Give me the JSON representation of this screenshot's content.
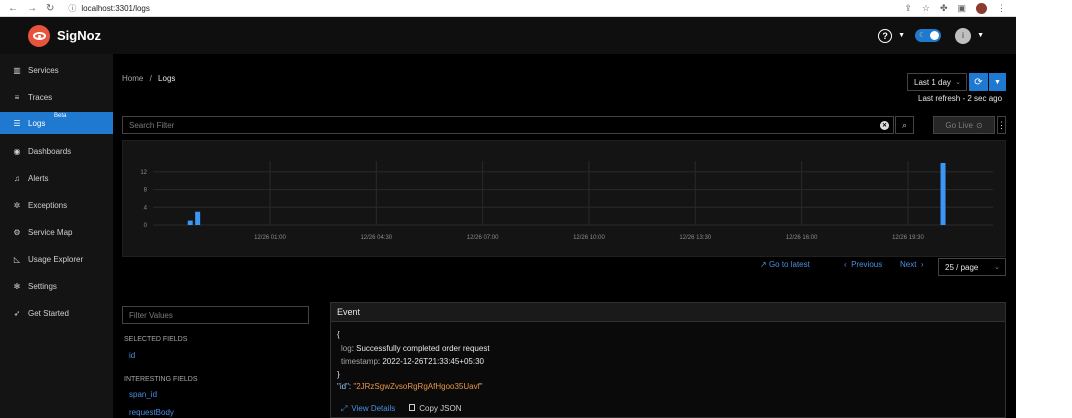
{
  "browser": {
    "url": "localhost:3301/logs"
  },
  "app": {
    "name": "SigNoz",
    "avatar_letter": "i"
  },
  "colors": {
    "accent": "#1f79d0",
    "logo": "#e8543b",
    "link": "#4a90e2",
    "bar": "#3a97f5"
  },
  "sidebar": {
    "items": [
      {
        "label": "Services",
        "icon": "bar-chart-icon"
      },
      {
        "label": "Traces",
        "icon": "menu-icon"
      },
      {
        "label": "Logs",
        "icon": "list-icon",
        "badge": "Beta",
        "active": true
      },
      {
        "label": "Dashboards",
        "icon": "dashboard-icon"
      },
      {
        "label": "Alerts",
        "icon": "bell-icon"
      },
      {
        "label": "Exceptions",
        "icon": "bug-icon"
      },
      {
        "label": "Service Map",
        "icon": "deployment-icon"
      },
      {
        "label": "Usage Explorer",
        "icon": "line-chart-icon"
      },
      {
        "label": "Settings",
        "icon": "gear-icon"
      },
      {
        "label": "Get Started",
        "icon": "rocket-icon"
      }
    ]
  },
  "main": {
    "breadcrumb": {
      "home": "Home",
      "sep": "/",
      "current": "Logs"
    },
    "time_range": "Last 1 day",
    "last_refresh": "Last refresh - 2 sec ago",
    "search_placeholder": "Search Filter",
    "go_live": "Go Live",
    "pagination": {
      "go_to_latest": "Go to latest",
      "previous": "Previous",
      "next": "Next",
      "page_size": "25 / page"
    }
  },
  "chart_data": {
    "type": "bar",
    "yticks": [
      "12",
      "8",
      "4",
      "0"
    ],
    "ylim": [
      0,
      14
    ],
    "x_tick_labels": [
      "12/26 01:00",
      "12/26 04:30",
      "12/26 07:00",
      "12/26 10:00",
      "12/26 13:30",
      "12/26 16:00",
      "12/26 19:30"
    ],
    "x_tick_positions": [
      1,
      2,
      3,
      4,
      5,
      6,
      7
    ],
    "x_range": [
      -0.1,
      7.8
    ],
    "bars": [
      {
        "x": 0.25,
        "value": 1
      },
      {
        "x": 0.32,
        "value": 3
      },
      {
        "x": 7.33,
        "value": 14
      }
    ],
    "grid": true
  },
  "filters": {
    "placeholder": "Filter Values",
    "selected_heading": "SELECTED FIELDS",
    "selected": [
      "id"
    ],
    "interesting_heading": "INTERESTING FIELDS",
    "interesting": [
      "span_id",
      "requestBody"
    ]
  },
  "event": {
    "header": "Event",
    "open_brace": "{",
    "log_key": "log",
    "log_value": "Successfully completed order request",
    "timestamp_key": "timestamp",
    "timestamp_value": "2022-12-26T21:33:45+05:30",
    "close_brace": "}",
    "id_key": "\"id\"",
    "id_value": "\"2JRzSgwZvsoRgRgAfHgoo35Uavf\"",
    "view_details": "View Details",
    "copy_json": "Copy JSON"
  }
}
